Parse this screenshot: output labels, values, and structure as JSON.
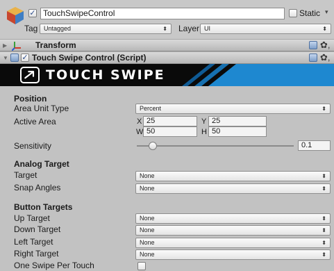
{
  "object": {
    "name": "TouchSwipeControl",
    "active_check": "✓",
    "static_label": "Static",
    "static_arrow": "▾",
    "tag_label": "Tag",
    "tag_value": "Untagged",
    "layer_label": "Layer",
    "layer_value": "UI"
  },
  "components": {
    "transform_title": "Transform",
    "script_title": "Touch Swipe Control (Script)",
    "script_check": "✓",
    "gear_glyph": "✿,"
  },
  "banner": {
    "title": "TOUCH SWIPE",
    "bg_color": "#0a0a0a",
    "accent_color": "#1e88d0"
  },
  "position": {
    "header": "Position",
    "area_unit_type_label": "Area Unit Type",
    "area_unit_type_value": "Percent",
    "active_area_label": "Active Area",
    "x_label": "X",
    "x_value": "25",
    "y_label": "Y",
    "y_value": "25",
    "w_label": "W",
    "w_value": "50",
    "h_label": "H",
    "h_value": "50",
    "sensitivity_label": "Sensitivity",
    "sensitivity_value": "0.1",
    "sensitivity_fraction": 0.1
  },
  "analog": {
    "header": "Analog Target",
    "target_label": "Target",
    "target_value": "None",
    "snap_label": "Snap Angles",
    "snap_value": "None"
  },
  "buttons": {
    "header": "Button Targets",
    "up_label": "Up Target",
    "up_value": "None",
    "down_label": "Down Target",
    "down_value": "None",
    "left_label": "Left Target",
    "left_value": "None",
    "right_label": "Right Target",
    "right_value": "None",
    "one_swipe_label": "One Swipe Per Touch"
  },
  "icons": {
    "dropdown_arrow": "⬍",
    "fold_open": "▼",
    "fold_closed": "▶"
  }
}
